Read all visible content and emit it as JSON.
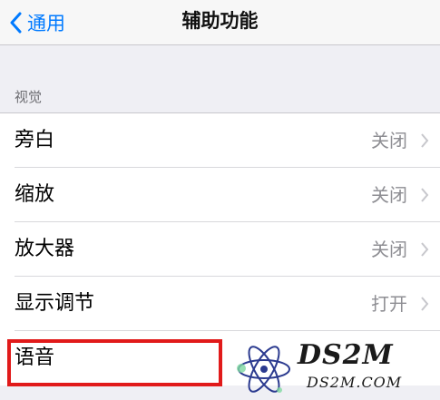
{
  "nav": {
    "back_label": "通用",
    "title": "辅助功能"
  },
  "section": {
    "header": "视觉"
  },
  "rows": [
    {
      "label": "旁白",
      "value": "关闭"
    },
    {
      "label": "缩放",
      "value": "关闭"
    },
    {
      "label": "放大器",
      "value": "关闭"
    },
    {
      "label": "显示调节",
      "value": "打开"
    },
    {
      "label": "语音",
      "value": ""
    }
  ],
  "watermark": {
    "brand": "DS2M",
    "url": "DS2M.COM"
  },
  "colors": {
    "accent": "#007aff",
    "highlight": "#e11a1a",
    "background": "#efeff4",
    "secondary_text": "#8e8e93"
  },
  "icons": {
    "back": "chevron-left-icon",
    "row": "chevron-right-icon",
    "watermark": "atom-logo-icon"
  }
}
